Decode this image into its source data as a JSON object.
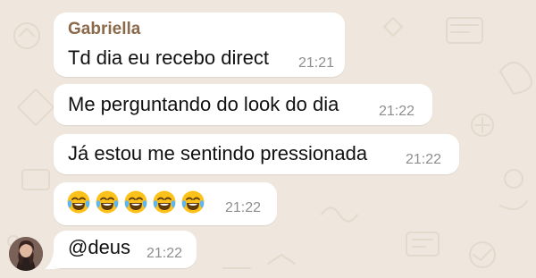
{
  "chat": {
    "sender_name": "Gabriella",
    "messages": [
      {
        "text": "Td dia eu recebo direct",
        "time": "21:21"
      },
      {
        "text": "Me perguntando do look do dia",
        "time": "21:22"
      },
      {
        "text": "Já estou me sentindo pressionada",
        "time": "21:22"
      },
      {
        "emoji": "😂",
        "emoji_count": 5,
        "time": "21:22"
      },
      {
        "text": "@deus",
        "time": "21:22"
      }
    ]
  },
  "colors": {
    "chat_background": "#efe7dd",
    "bubble": "#ffffff",
    "sender_name": "#8a6a4a",
    "timestamp": "#8e8e8e"
  },
  "icons": [
    "laughing-crying-emoji",
    "avatar"
  ]
}
